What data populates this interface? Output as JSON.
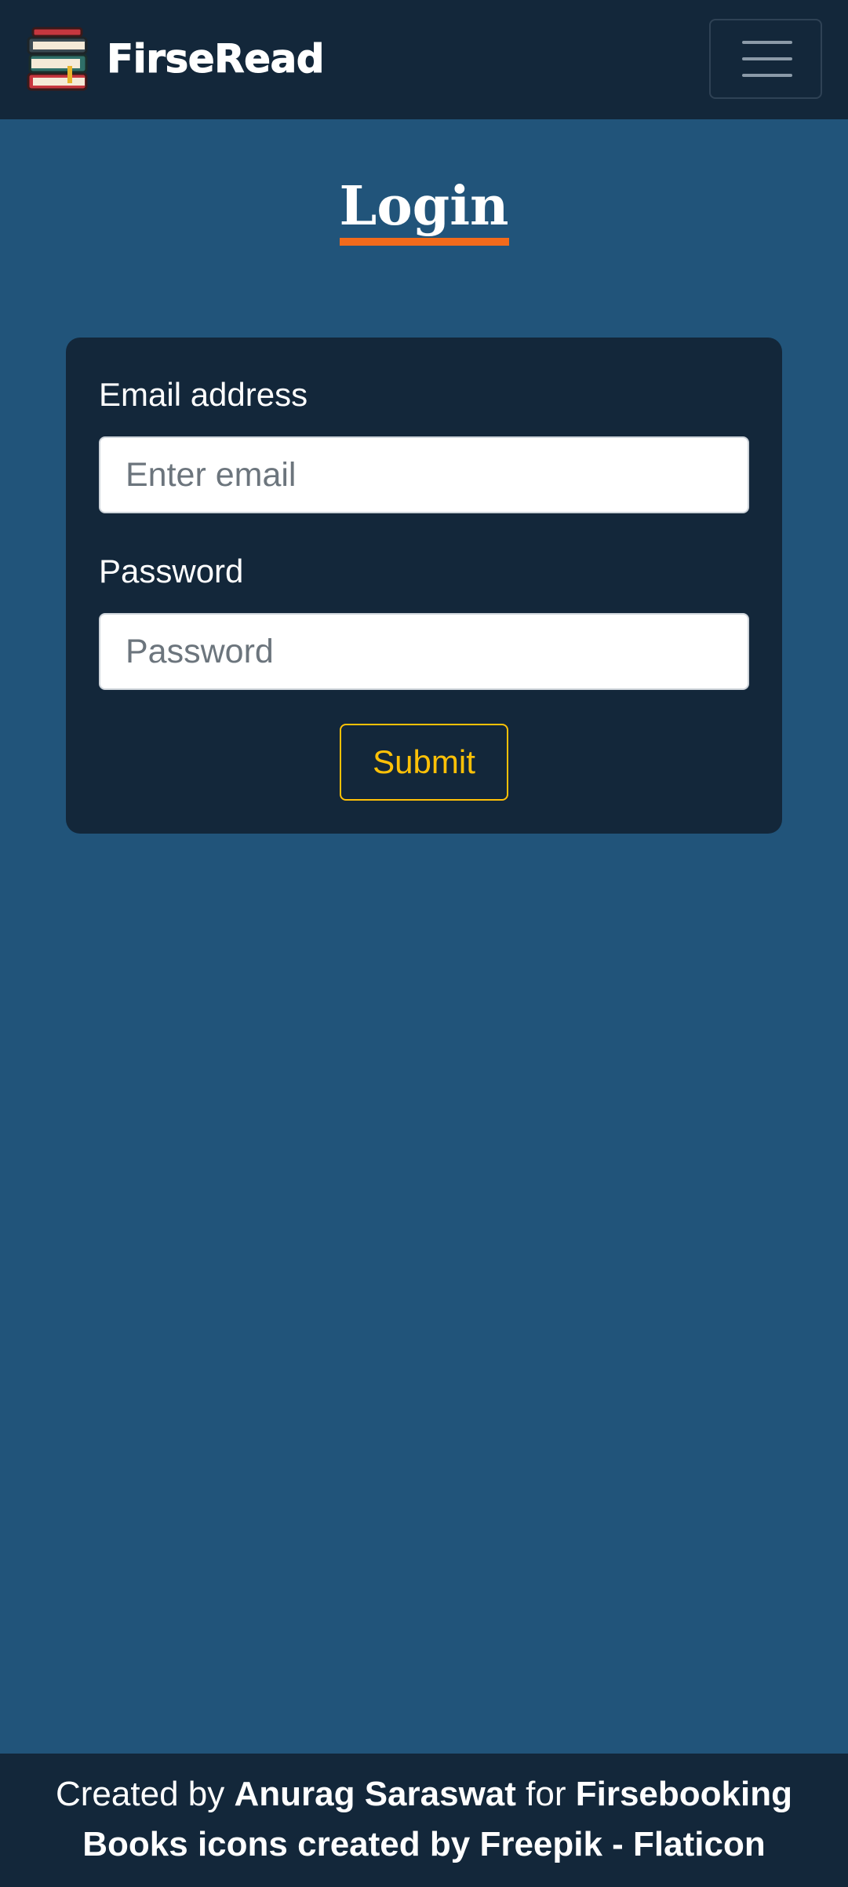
{
  "navbar": {
    "brand_name": "FirseRead",
    "logo_icon": "books-stack-icon",
    "toggler_icon": "hamburger-menu-icon"
  },
  "page": {
    "title": "Login"
  },
  "form": {
    "email_label": "Email address",
    "email_placeholder": "Enter email",
    "email_value": "",
    "password_label": "Password",
    "password_placeholder": "Password",
    "password_value": "",
    "submit_label": "Submit"
  },
  "footer": {
    "prefix": "Created by ",
    "author": "Anurag Saraswat",
    "middle": " for ",
    "project": "Firsebooking",
    "attribution": "Books icons created by Freepik - Flaticon"
  },
  "colors": {
    "background": "#21547a",
    "navbar": "#13273a",
    "card": "#13273a",
    "title_underline": "#f26a1b",
    "submit_accent": "#ffc107"
  }
}
